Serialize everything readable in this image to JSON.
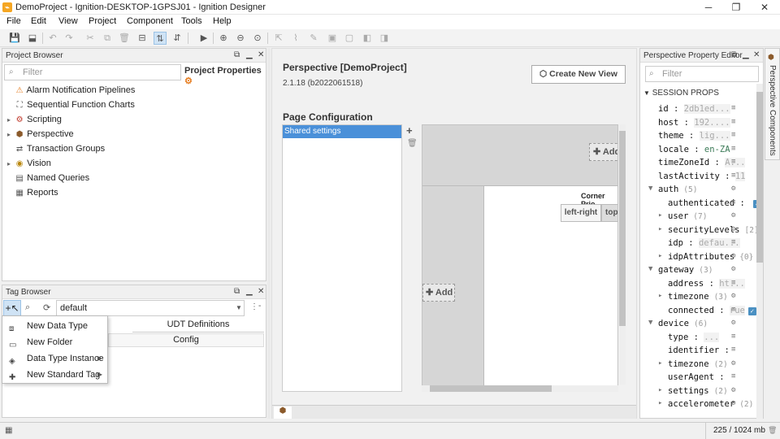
{
  "titlebar": {
    "title": "DemoProject - Ignition-DESKTOP-1GPSJ01 - Ignition Designer"
  },
  "menu": [
    "File",
    "Edit",
    "View",
    "Project",
    "Component",
    "Tools",
    "Help"
  ],
  "project_browser": {
    "title": "Project Browser",
    "filter_placeholder": "Filter",
    "properties_label": "Project Properties",
    "items": [
      {
        "label": "Alarm Notification Pipelines",
        "icon": "alarm-pipeline-icon",
        "expandable": false
      },
      {
        "label": "Sequential Function Charts",
        "icon": "sfc-icon",
        "expandable": false
      },
      {
        "label": "Scripting",
        "icon": "scripting-icon",
        "expandable": true
      },
      {
        "label": "Perspective",
        "icon": "perspective-icon",
        "expandable": true
      },
      {
        "label": "Transaction Groups",
        "icon": "transaction-groups-icon",
        "expandable": false
      },
      {
        "label": "Vision",
        "icon": "vision-icon",
        "expandable": true
      },
      {
        "label": "Named Queries",
        "icon": "named-queries-icon",
        "expandable": false
      },
      {
        "label": "Reports",
        "icon": "reports-icon",
        "expandable": false
      }
    ]
  },
  "tag_browser": {
    "title": "Tag Browser",
    "provider": "default",
    "tab_udt": "UDT Definitions",
    "col_config": "Config",
    "dropdown": [
      {
        "label": "New Data Type",
        "icon": "data-type-icon",
        "submenu": false
      },
      {
        "label": "New Folder",
        "icon": "folder-icon",
        "submenu": false
      },
      {
        "label": "Data Type Instance",
        "icon": "instance-icon",
        "submenu": true
      },
      {
        "label": "New Standard Tag",
        "icon": "tag-icon",
        "submenu": true
      }
    ]
  },
  "center": {
    "title": "Perspective [DemoProject]",
    "version": "2.1.18 (b2022061518)",
    "create_view": "Create New View",
    "page_config": "Page Configuration",
    "shared_settings": "Shared settings",
    "add_label": "Add",
    "corner_priority": "Corner Prio",
    "btn_left_right": "left-right",
    "btn_top": "top-"
  },
  "property_editor": {
    "title": "Perspective Property Editor",
    "filter_placeholder": "Filter",
    "section": "SESSION PROPS",
    "side_tab": "Perspective Components",
    "rows": [
      {
        "key": "id",
        "value": "2db1ed...",
        "indent": 0,
        "exp": ""
      },
      {
        "key": "host",
        "value": "192....",
        "indent": 0,
        "exp": ""
      },
      {
        "key": "theme",
        "value": "lig...",
        "indent": 0,
        "exp": ""
      },
      {
        "key": "locale",
        "value": "en-ZA",
        "indent": 0,
        "exp": "",
        "dark": true
      },
      {
        "key": "timeZoneId",
        "value": "A...",
        "indent": 0,
        "exp": ""
      },
      {
        "key": "lastActivity",
        "value": "11",
        "indent": 0,
        "exp": ""
      },
      {
        "key": "auth",
        "count": "(5)",
        "indent": 0,
        "exp": "open"
      },
      {
        "key": "authenticated",
        "value": "",
        "indent": 1,
        "exp": "",
        "check": true
      },
      {
        "key": "user",
        "count": "(7)",
        "indent": 1,
        "exp": "closed"
      },
      {
        "key": "securityLevels",
        "count": "[2]",
        "indent": 1,
        "exp": "closed"
      },
      {
        "key": "idp",
        "value": "defau...",
        "indent": 1,
        "exp": ""
      },
      {
        "key": "idpAttributes",
        "count": "{0}",
        "indent": 1,
        "exp": "closed"
      },
      {
        "key": "gateway",
        "count": "(3)",
        "indent": 0,
        "exp": "open"
      },
      {
        "key": "address",
        "value": "ht...",
        "indent": 1,
        "exp": ""
      },
      {
        "key": "timezone",
        "count": "(3)",
        "indent": 1,
        "exp": "closed"
      },
      {
        "key": "connected",
        "value": "rue",
        "indent": 1,
        "exp": "",
        "check": true
      },
      {
        "key": "device",
        "count": "(6)",
        "indent": 0,
        "exp": "open"
      },
      {
        "key": "type",
        "value": "...",
        "indent": 1,
        "exp": ""
      },
      {
        "key": "identifier",
        "value": "",
        "indent": 1,
        "exp": ""
      },
      {
        "key": "timezone",
        "count": "(2)",
        "indent": 1,
        "exp": "closed"
      },
      {
        "key": "userAgent",
        "value": "",
        "indent": 1,
        "exp": ""
      },
      {
        "key": "settings",
        "count": "(2)",
        "indent": 1,
        "exp": "closed"
      },
      {
        "key": "accelerometer",
        "count": "(2)",
        "indent": 1,
        "exp": "closed"
      }
    ]
  },
  "status": {
    "memory": "225 / 1024 mb"
  }
}
